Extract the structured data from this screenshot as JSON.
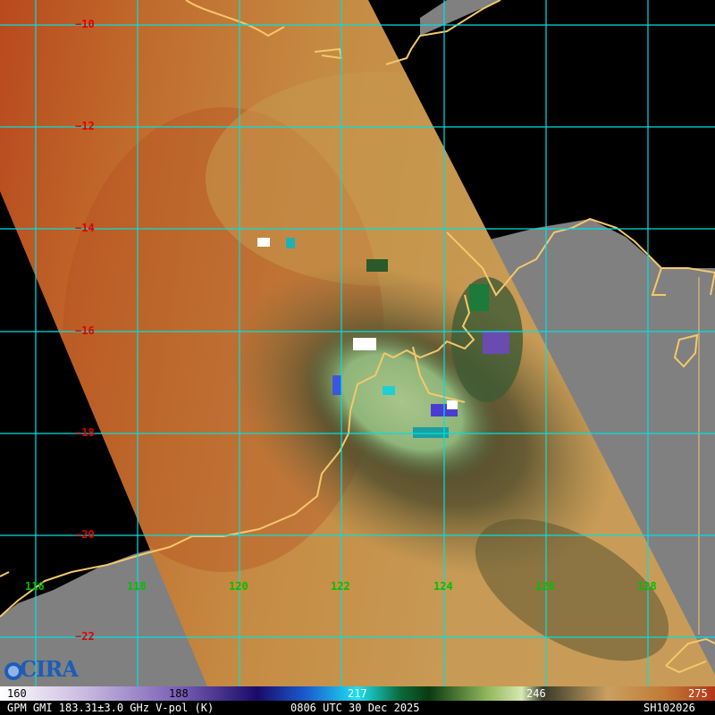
{
  "product": {
    "sensor_label": "GPM GMI 183.31±3.0 GHz V-pol (K)",
    "time_label": "0806 UTC 30 Dec 2025",
    "storm_id": "SH102026",
    "logo_text": "CIRA"
  },
  "grid": {
    "lat_labels": [
      "−10",
      "−12",
      "−14",
      "−16",
      "−18",
      "−20",
      "−22"
    ],
    "lon_labels": [
      "116",
      "118",
      "120",
      "122",
      "124",
      "126",
      "128"
    ],
    "lat_values": [
      -10,
      -12,
      -14,
      -16,
      -18,
      -20,
      -22
    ],
    "lon_values": [
      116,
      118,
      120,
      122,
      124,
      126,
      128
    ]
  },
  "colorbar": {
    "ticks": [
      "160",
      "188",
      "217",
      "246",
      "275"
    ],
    "min": 160,
    "max": 275
  },
  "colors": {
    "grid": "#00e0e0",
    "coast": "#f5c86a",
    "land_outside_swath": "#808080",
    "lat_label": "#e00000",
    "lon_label": "#00c000"
  }
}
